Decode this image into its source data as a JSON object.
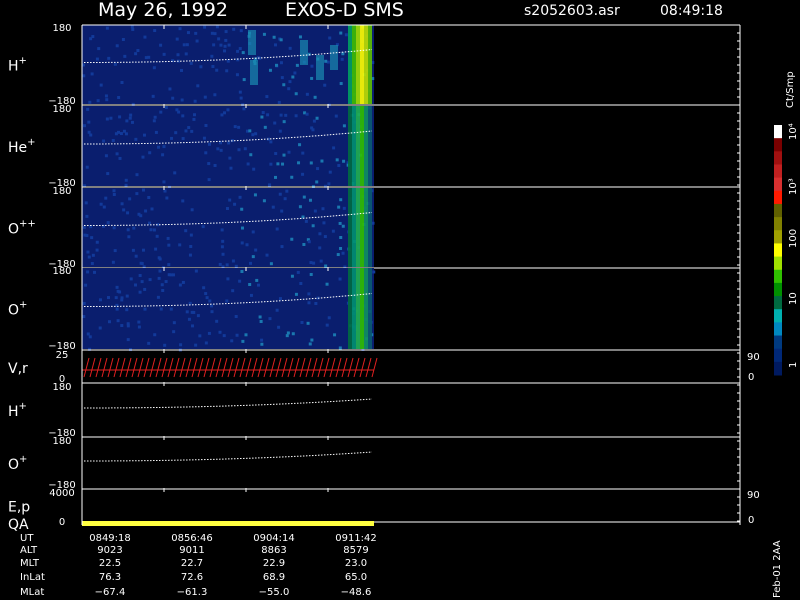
{
  "header": {
    "date": "May 26, 1992",
    "instrument": "EXOS-D SMS",
    "file": "s2052603.asr",
    "time": "08:49:18"
  },
  "panels": [
    {
      "id": "h",
      "label": "H",
      "sup": "+",
      "ytop": "180",
      "ybot": "−180"
    },
    {
      "id": "he",
      "label": "He",
      "sup": "+",
      "ytop": "180",
      "ybot": "−180"
    },
    {
      "id": "oo",
      "label": "O",
      "sup": "++",
      "ytop": "180",
      "ybot": "−180"
    },
    {
      "id": "o",
      "label": "O",
      "sup": "+",
      "ytop": "180",
      "ybot": "−180"
    },
    {
      "id": "vr",
      "label": "V,r",
      "sup": "",
      "ytop": "25",
      "ybot": "0",
      "rtop": "90",
      "rbot": "0"
    },
    {
      "id": "h2",
      "label": "H",
      "sup": "+",
      "ytop": "180",
      "ybot": "−180"
    },
    {
      "id": "o2",
      "label": "O",
      "sup": "+",
      "ytop": "180",
      "ybot": "−180"
    },
    {
      "id": "ep",
      "label": "E,p",
      "sup": "",
      "ytop": "4000",
      "ybot": "",
      "rtop": "90",
      "rbot": ""
    },
    {
      "id": "qa",
      "label": "QA",
      "sup": "",
      "ytop": "",
      "ybot": "0",
      "rtop": "",
      "rbot": "0"
    }
  ],
  "colorbar": {
    "unit": "Ct/Smp",
    "labels": [
      "10⁴",
      "10³",
      "100",
      "10",
      "1"
    ],
    "colors": [
      "#ffffff",
      "#7a0000",
      "#a01010",
      "#c02020",
      "#d83030",
      "#ff1a00",
      "#606000",
      "#808000",
      "#a0a000",
      "#ffff00",
      "#a0e000",
      "#30c000",
      "#009000",
      "#006a40",
      "#00b0b0",
      "#0088c0",
      "#003a80",
      "#002878",
      "#001a60"
    ]
  },
  "bottom_table": {
    "rows": [
      {
        "name": "UT",
        "values": [
          "0849:18",
          "0856:46",
          "0904:14",
          "0911:42"
        ]
      },
      {
        "name": "ALT",
        "values": [
          "9023",
          "9011",
          "8863",
          "8579"
        ]
      },
      {
        "name": "MLT",
        "values": [
          "22.5",
          "22.7",
          "22.9",
          "23.0"
        ]
      },
      {
        "name": "InLat",
        "values": [
          "76.3",
          "72.6",
          "68.9",
          "65.0"
        ]
      },
      {
        "name": "MLat",
        "values": [
          "−67.4",
          "−61.3",
          "−55.0",
          "−48.6"
        ]
      }
    ]
  },
  "footer_code": "Feb-01 2AA",
  "colors": {
    "background": "#000000",
    "spectrogram_bg": "#0a1e6e",
    "trace": "#ffffff",
    "vr_trace": "#e02020",
    "qa_bar": "#ffff40"
  },
  "chart_data": {
    "type": "heatmap",
    "title": "May 26, 1992   EXOS-D SMS",
    "x_ticks": [
      "0849:18",
      "0856:46",
      "0904:14",
      "0911:42"
    ],
    "series": [
      {
        "name": "H+",
        "y_range": [
          -180,
          180
        ]
      },
      {
        "name": "He+",
        "y_range": [
          -180,
          180
        ]
      },
      {
        "name": "O++",
        "y_range": [
          -180,
          180
        ]
      },
      {
        "name": "O+",
        "y_range": [
          -180,
          180
        ]
      },
      {
        "name": "V,r",
        "y_range": [
          0,
          25
        ],
        "right_range": [
          0,
          90
        ]
      },
      {
        "name": "H+",
        "y_range": [
          -180,
          180
        ]
      },
      {
        "name": "O+",
        "y_range": [
          -180,
          180
        ]
      },
      {
        "name": "E,p",
        "y_range": [
          0,
          4000
        ],
        "right_range": [
          0,
          90
        ]
      },
      {
        "name": "QA",
        "y_range": [
          0,
          0
        ]
      }
    ],
    "colorbar_unit": "Ct/Smp",
    "colorbar_ticks": [
      "1",
      "10",
      "100",
      "10³",
      "10⁴"
    ]
  }
}
